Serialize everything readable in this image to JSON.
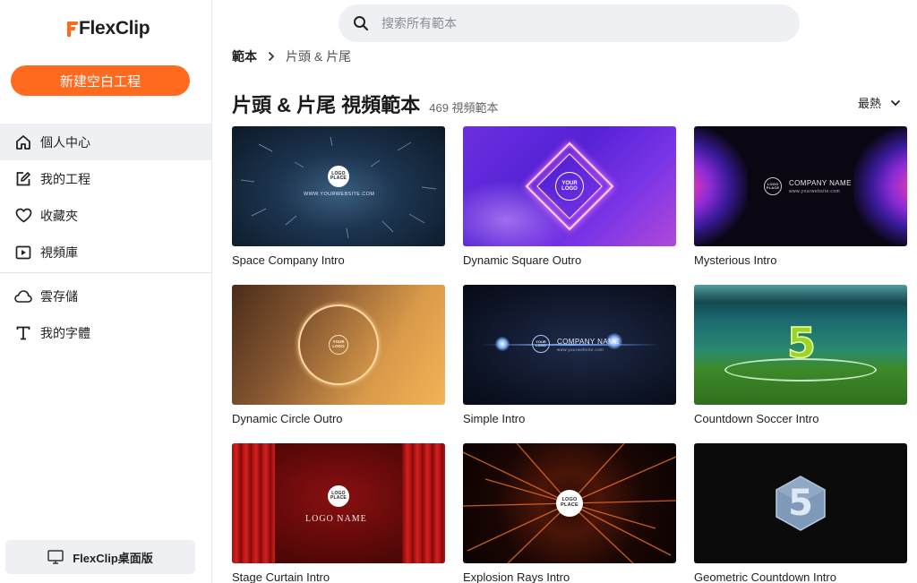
{
  "app": {
    "brand": "FlexClip",
    "new_project": "新建空白工程",
    "desktop": "FlexClip桌面版"
  },
  "sidebar": {
    "items": [
      {
        "label": "個人中心",
        "icon": "home-icon"
      },
      {
        "label": "我的工程",
        "icon": "edit-icon"
      },
      {
        "label": "收藏夾",
        "icon": "heart-icon"
      },
      {
        "label": "視頻庫",
        "icon": "video-library-icon"
      }
    ],
    "items2": [
      {
        "label": "雲存儲",
        "icon": "cloud-icon"
      },
      {
        "label": "我的字體",
        "icon": "font-icon"
      }
    ]
  },
  "search": {
    "placeholder": "搜索所有範本"
  },
  "breadcrumb": {
    "home": "範本",
    "current": "片頭 & 片尾"
  },
  "page": {
    "title": "片頭 & 片尾 視頻範本",
    "count": "469 視頻範本",
    "sort": "最熱"
  },
  "templates": [
    {
      "title": "Space Company Intro",
      "logo": "LOGO\nPLACE",
      "caption": "WWW.YOURWEBSITE.COM"
    },
    {
      "title": "Dynamic Square Outro",
      "logo": "YOUR\nLOGO"
    },
    {
      "title": "Mysterious Intro",
      "logo": "LOGO\nPLACE",
      "caption": "COMPANY NAME",
      "caption2": "www.yourwebsite.com"
    },
    {
      "title": "Dynamic Circle Outro",
      "logo": "YOUR\nLOGO"
    },
    {
      "title": "Simple Intro",
      "logo": "YOUR\nLOGO",
      "caption": "COMPANY NAME",
      "caption2": "www.yourwebsite.com"
    },
    {
      "title": "Countdown Soccer Intro",
      "number": "5"
    },
    {
      "title": "Stage Curtain Intro",
      "logo": "LOGO\nPLACE",
      "caption": "LOGO NAME"
    },
    {
      "title": "Explosion Rays Intro",
      "logo": "LOGO\nPLACE"
    },
    {
      "title": "Geometric Countdown Intro",
      "number": "5"
    }
  ],
  "colors": {
    "accent": "#ff6a1f",
    "sidebar_active": "#eff0f4"
  }
}
